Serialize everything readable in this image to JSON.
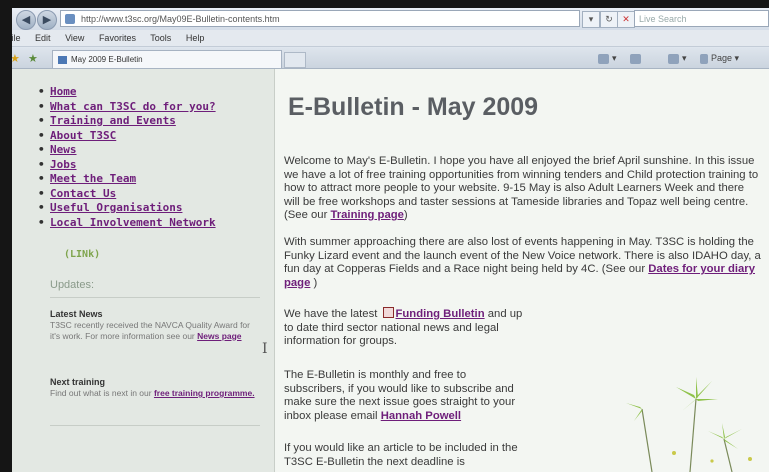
{
  "browser": {
    "url": "http://www.t3sc.org/May09E-Bulletin-contents.htm",
    "search_placeholder": "Live Search",
    "tab_title": "May 2009 E-Bulletin",
    "menu": [
      "File",
      "Edit",
      "View",
      "Favorites",
      "Tools",
      "Help"
    ],
    "page_menu": "Page"
  },
  "sidebar": {
    "nav": [
      "Home",
      "What can T3SC do for you?",
      "Training and Events",
      "About T3SC",
      "News",
      "Jobs",
      "Meet the Team",
      "Contact Us",
      "Useful Organisations",
      "Local Involvement Network"
    ],
    "link_sub": "(LINk)",
    "updates_heading": "Updates:",
    "latest_news": {
      "heading": "Latest News",
      "text": "T3SC recently received the NAVCA Quality Award for it's work. For more information see our ",
      "link": "News page"
    },
    "next_training": {
      "heading": "Next training",
      "text": "Find out what is next in our ",
      "link": "free training programme."
    }
  },
  "main": {
    "title": "E-Bulletin - May 2009",
    "p1": "Welcome to May's E-Bulletin. I hope you have all enjoyed the brief April sunshine. In this issue we have a lot of free training opportunities from winning tenders and Child protection training to how to attract more people to your website. 9-15 May is also Adult Learners Week and there will be free workshops and taster sessions at Tameside libraries and Topaz well being centre. (See our ",
    "p1_link": "Training page",
    "p1_end": ")",
    "p2": "With summer approaching there are also lost of events happening in May. T3SC is holding the Funky Lizard event and the launch event of the New Voice network. There is also IDAHO day, a fun day at Copperas Fields and a Race night being held by 4C. (See our ",
    "p2_link": "Dates for your diary page",
    "p2_end": " )",
    "p3_a": "We have the latest ",
    "p3_link": "Funding Bulletin",
    "p3_b": " and up to date third sector national news and legal information for groups.",
    "p4": "The E-Bulletin is monthly and free to subscribers, if you would like to subscribe and make sure the next issue goes straight to your inbox please email ",
    "p4_link": "Hannah Powell",
    "p5": "If you would like an article to be included in the T3SC E-Bulletin the next deadline is"
  }
}
